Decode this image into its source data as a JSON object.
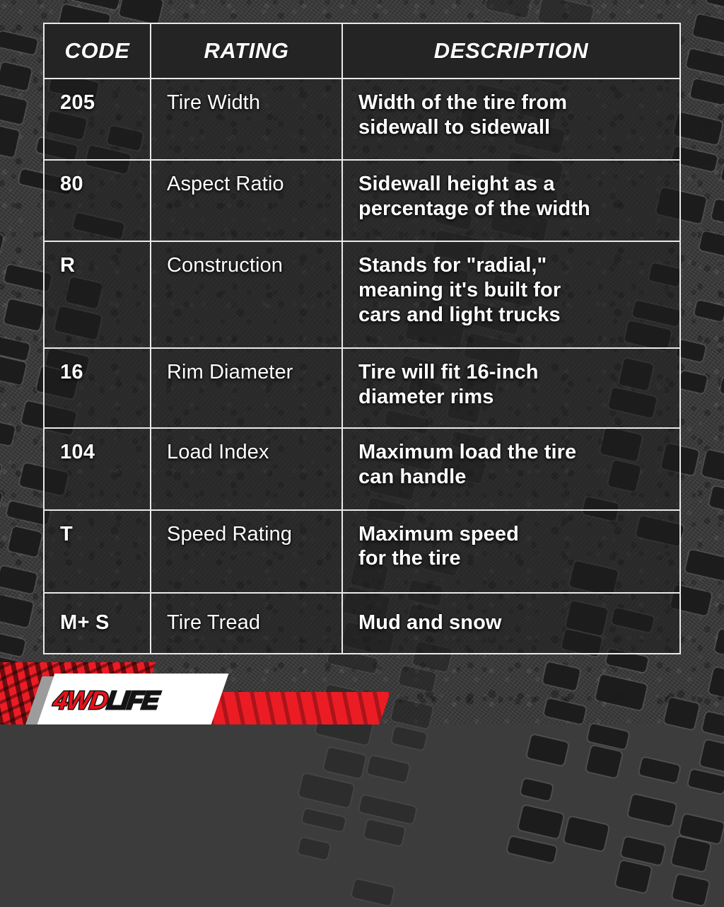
{
  "brand": {
    "logo_primary": "4WD",
    "logo_secondary": "LIFE",
    "accent_red": "#ec1c24",
    "plate_white": "#ffffff",
    "ink_black": "#151515"
  },
  "theme": {
    "header_bg": "#242424",
    "cell_bg": "rgba(30,30,30,.55)",
    "border": "#e9e9e9",
    "text": "#ffffff"
  },
  "table": {
    "columns": [
      {
        "key": "code",
        "label": "CODE"
      },
      {
        "key": "rating",
        "label": "RATING"
      },
      {
        "key": "description",
        "label": "DESCRIPTION"
      }
    ],
    "rows": [
      {
        "code": "205",
        "rating": "Tire Width",
        "description": "Width of the tire from\nsidewall to sidewall"
      },
      {
        "code": "80",
        "rating": "Aspect Ratio",
        "description": "Sidewall height as a\npercentage of the width"
      },
      {
        "code": "R",
        "rating": "Construction",
        "description": "Stands for \"radial,\"\nmeaning it's built for\ncars and light trucks"
      },
      {
        "code": "16",
        "rating": "Rim Diameter",
        "description": "Tire will fit 16-inch\ndiameter rims"
      },
      {
        "code": "104",
        "rating": "Load Index",
        "description": "Maximum load the tire\ncan handle"
      },
      {
        "code": "T",
        "rating": "Speed Rating",
        "description": "Maximum speed\nfor the tire"
      },
      {
        "code": "M+ S",
        "rating": "Tire Tread",
        "description": "Mud and snow"
      }
    ]
  }
}
